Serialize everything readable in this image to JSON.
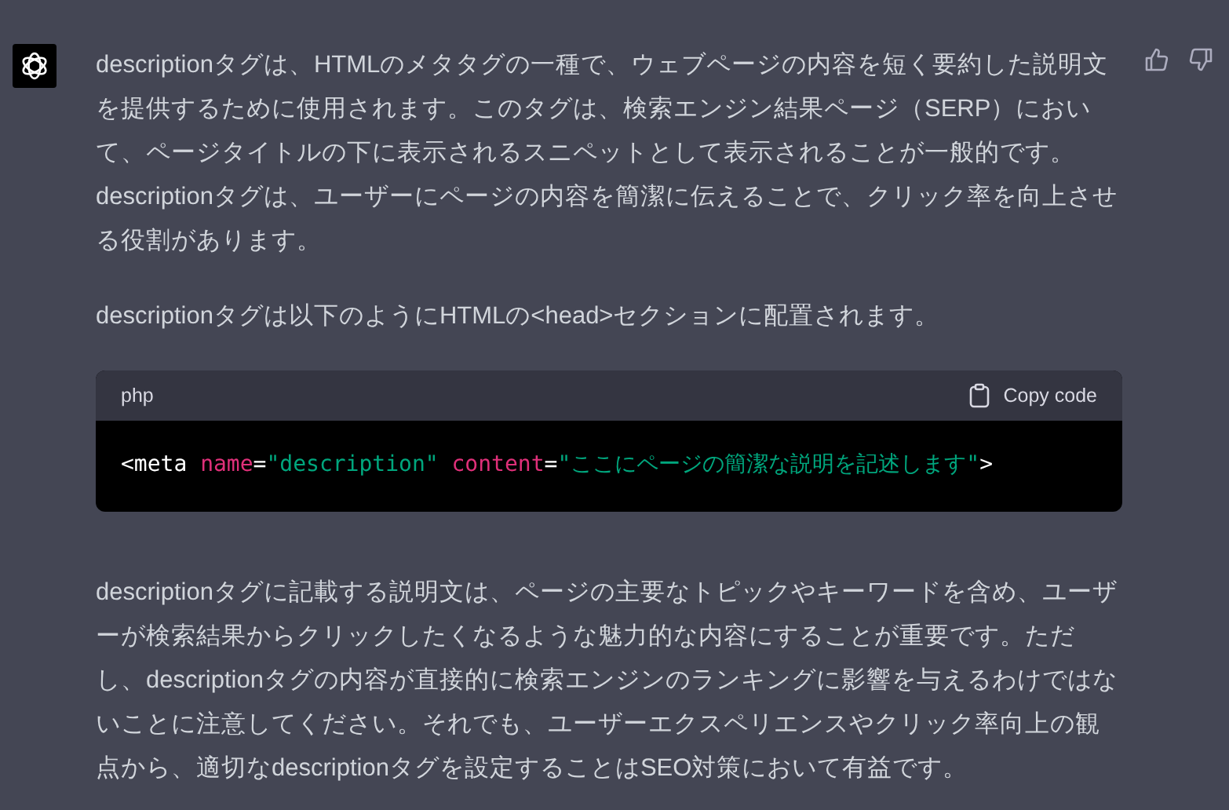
{
  "message": {
    "paragraphs_before": [
      "descriptionタグは、HTMLのメタタグの一種で、ウェブページの内容を短く要約した説明文を提供するために使用されます。このタグは、検索エンジン結果ページ（SERP）において、ページタイトルの下に表示されるスニペットとして表示されることが一般的です。descriptionタグは、ユーザーにページの内容を簡潔に伝えることで、クリック率を向上させる役割があります。",
      "descriptionタグは以下のようにHTMLの<head>セクションに配置されます。"
    ],
    "code_block": {
      "language": "php",
      "copy_label": "Copy code",
      "tokens": [
        {
          "kind": "plain",
          "text": "<meta "
        },
        {
          "kind": "attr",
          "text": "name"
        },
        {
          "kind": "plain",
          "text": "="
        },
        {
          "kind": "string",
          "text": "\"description\" "
        },
        {
          "kind": "attr",
          "text": "content"
        },
        {
          "kind": "plain",
          "text": "="
        },
        {
          "kind": "string",
          "text": "\"ここにページの簡潔な説明を記述します\""
        },
        {
          "kind": "plain",
          "text": ">"
        }
      ]
    },
    "paragraphs_after": [
      "descriptionタグに記載する説明文は、ページの主要なトピックやキーワードを含め、ユーザーが検索結果からクリックしたくなるような魅力的な内容にすることが重要です。ただし、descriptionタグの内容が直接的に検索エンジンのランキングに影響を与えるわけではないことに注意してください。それでも、ユーザーエクスペリエンスやクリック率向上の観点から、適切なdescriptionタグを設定することはSEO対策において有益です。"
    ]
  }
}
